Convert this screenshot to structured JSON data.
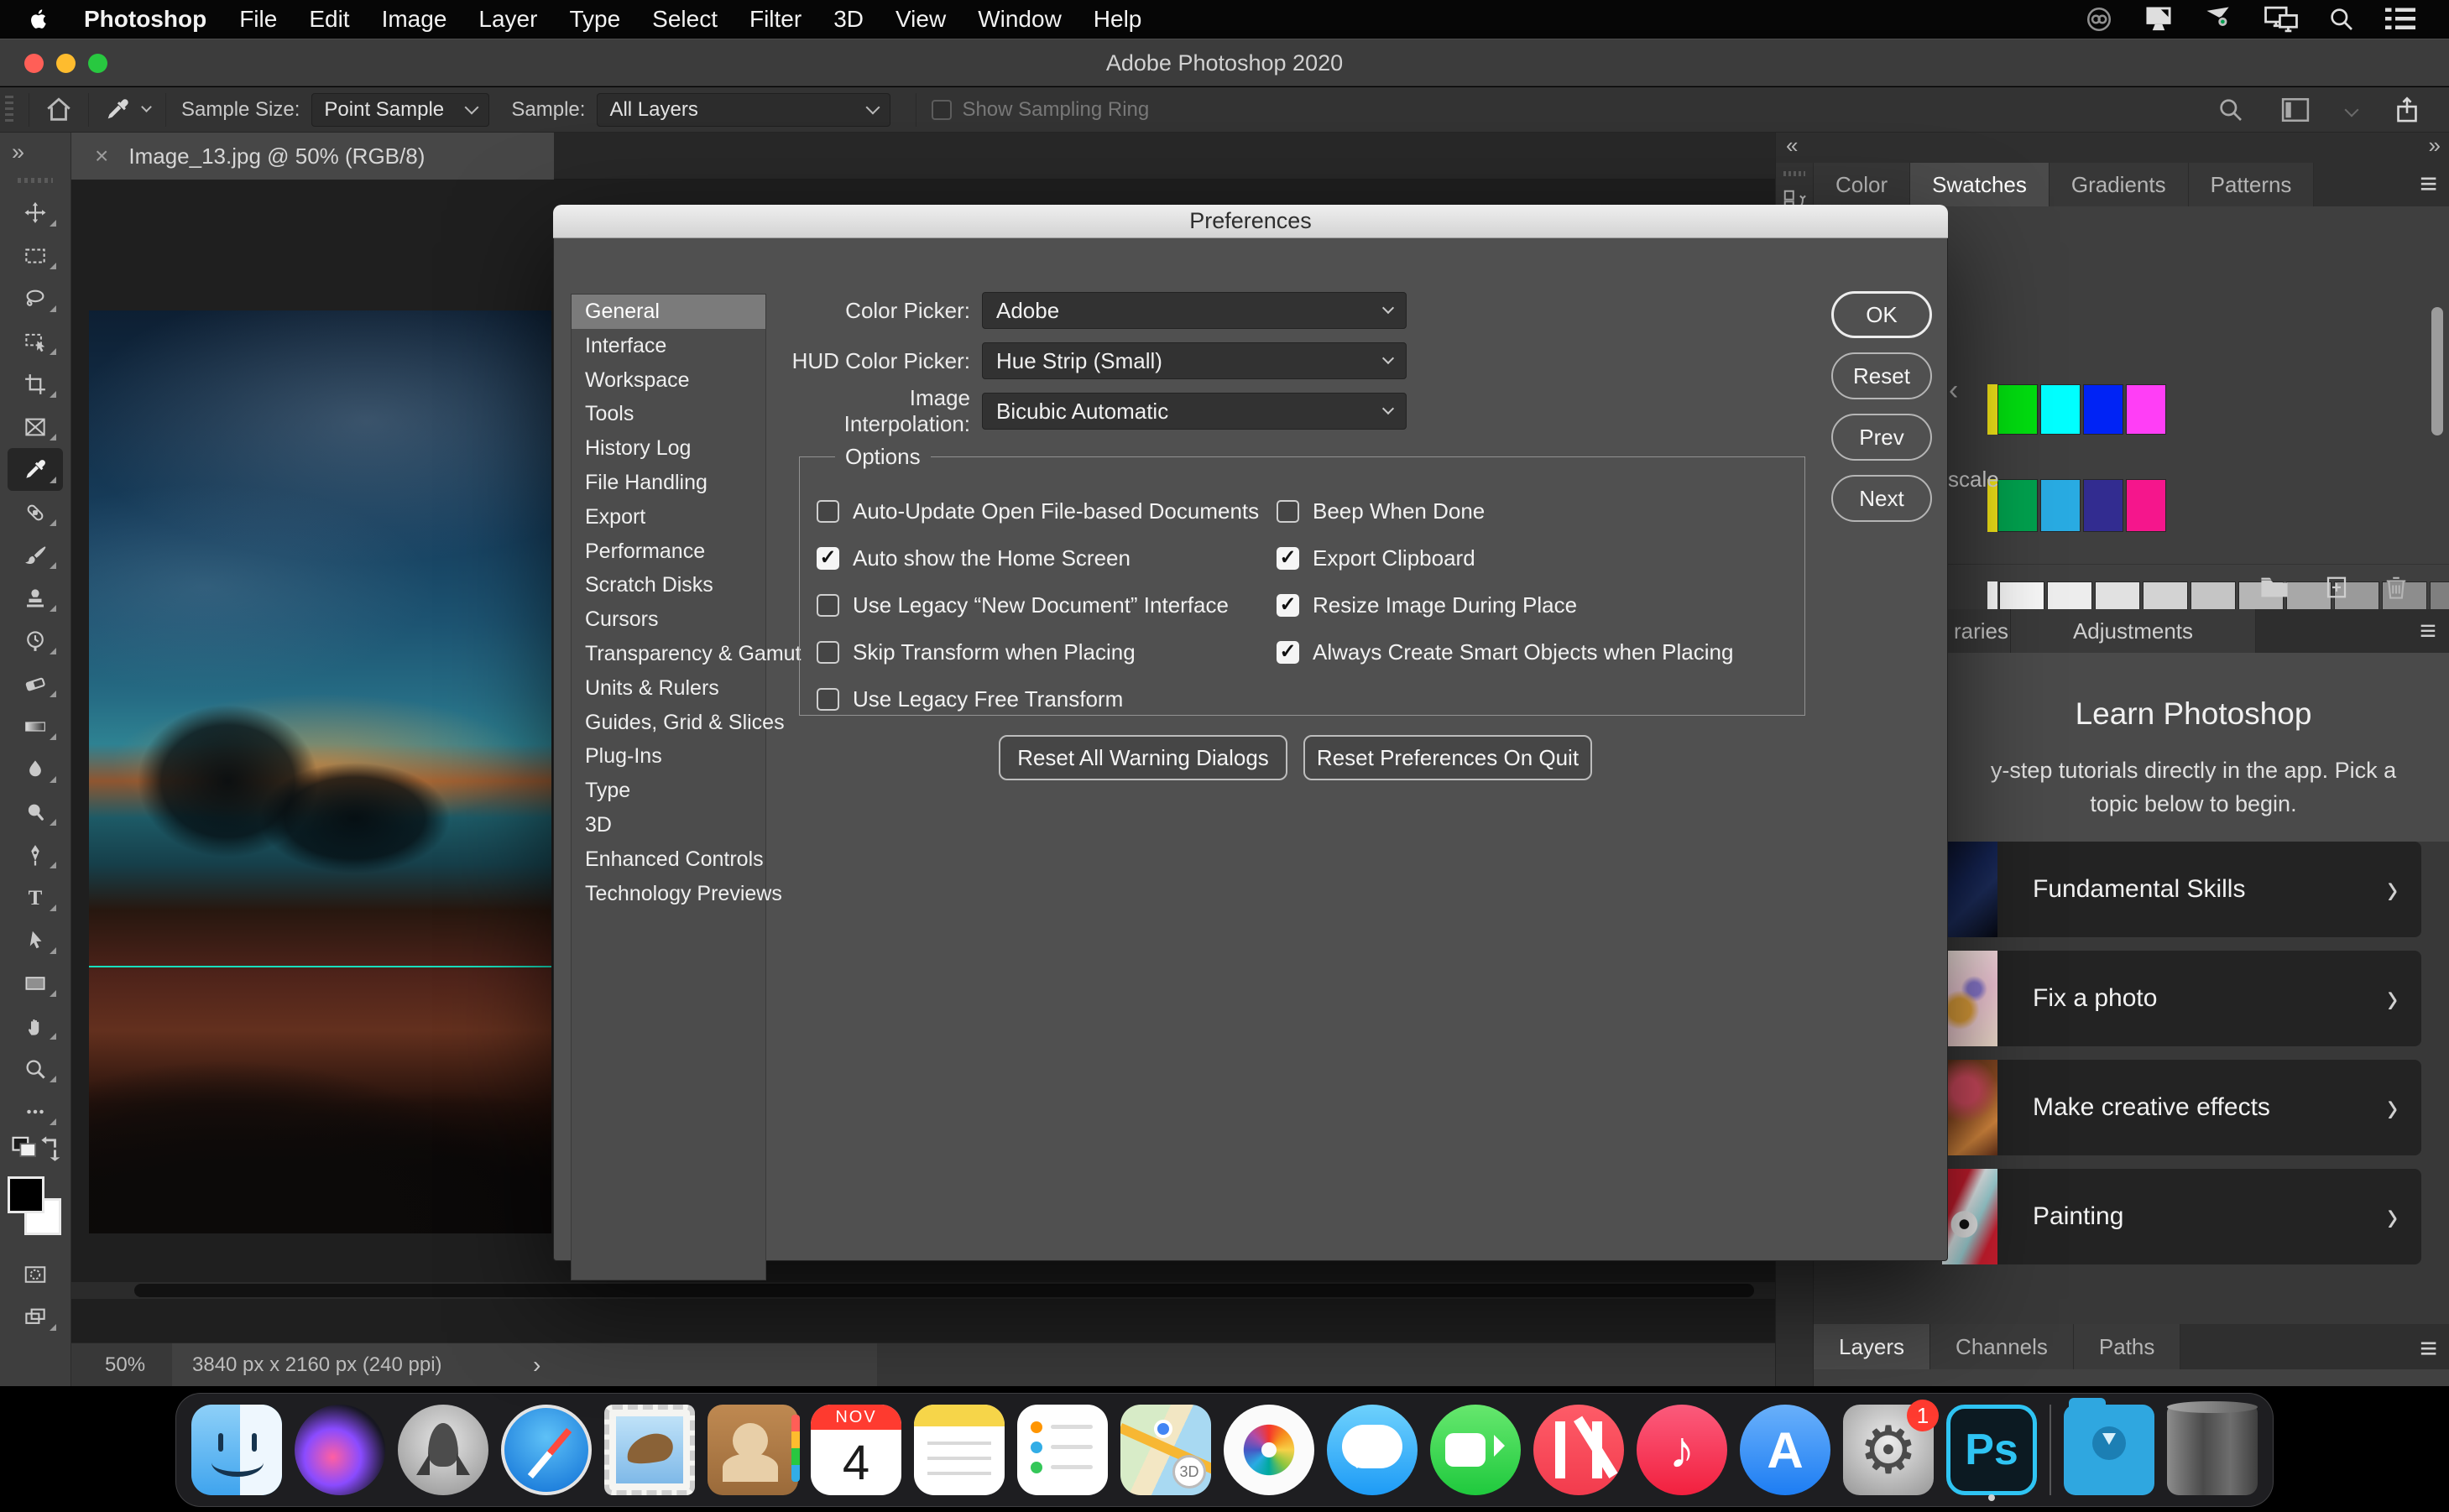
{
  "menu_bar": {
    "app_name": "Photoshop",
    "menus": [
      "File",
      "Edit",
      "Image",
      "Layer",
      "Type",
      "Select",
      "Filter",
      "3D",
      "View",
      "Window",
      "Help"
    ],
    "status_icons": [
      "creative-cloud",
      "display",
      "projector",
      "screen-mirroring",
      "spotlight",
      "notification-list"
    ]
  },
  "title_bar": {
    "title": "Adobe Photoshop 2020"
  },
  "options_bar": {
    "sample_size_label": "Sample Size:",
    "sample_size_value": "Point Sample",
    "sample_label": "Sample:",
    "sample_value": "All Layers",
    "sampling_ring_label": "Show Sampling Ring"
  },
  "document": {
    "tab_title": "Image_13.jpg @ 50% (RGB/8)",
    "zoom_level": "50%",
    "dimensions": "3840 px x 2160 px (240 ppi)"
  },
  "toolbar_tools": [
    "move",
    "marquee",
    "lasso",
    "object-selection",
    "crop",
    "frame",
    "eyedropper",
    "healing-brush",
    "brush",
    "clone-stamp",
    "history-brush",
    "eraser",
    "gradient",
    "blur",
    "dodge",
    "pen",
    "type",
    "path-selection",
    "rectangle",
    "hand",
    "zoom",
    "edit-toolbar",
    "quick-mask",
    "screen-mode"
  ],
  "toolbar_selected_tool": "eyedropper",
  "preferences": {
    "title": "Preferences",
    "sections": [
      {
        "label": "General",
        "selected": true
      },
      {
        "label": "Interface"
      },
      {
        "label": "Workspace"
      },
      {
        "label": "Tools"
      },
      {
        "label": "History Log"
      },
      {
        "label": "File Handling"
      },
      {
        "label": "Export"
      },
      {
        "label": "Performance"
      },
      {
        "label": "Scratch Disks"
      },
      {
        "label": "Cursors"
      },
      {
        "label": "Transparency & Gamut"
      },
      {
        "label": "Units & Rulers"
      },
      {
        "label": "Guides, Grid & Slices"
      },
      {
        "label": "Plug-Ins"
      },
      {
        "label": "Type"
      },
      {
        "label": "3D"
      },
      {
        "label": "Enhanced Controls"
      },
      {
        "label": "Technology Previews"
      }
    ],
    "fields": [
      {
        "label": "Color Picker:",
        "value": "Adobe"
      },
      {
        "label": "HUD Color Picker:",
        "value": "Hue Strip (Small)"
      },
      {
        "label": "Image Interpolation:",
        "value": "Bicubic Automatic"
      }
    ],
    "options_group": {
      "legend": "Options",
      "left": [
        {
          "label": "Auto-Update Open File-based Documents",
          "checked": false
        },
        {
          "label": "Auto show the Home Screen",
          "checked": true
        },
        {
          "label": "Use Legacy “New Document” Interface",
          "checked": false
        },
        {
          "label": "Skip Transform when Placing",
          "checked": false
        },
        {
          "label": "Use Legacy Free Transform",
          "checked": false
        }
      ],
      "right": [
        {
          "label": "Beep When Done",
          "checked": false
        },
        {
          "label": "Export Clipboard",
          "checked": true
        },
        {
          "label": "Resize Image During Place",
          "checked": true
        },
        {
          "label": "Always Create Smart Objects when Placing",
          "checked": true
        }
      ]
    },
    "footer_buttons": [
      "Reset All Warning Dialogs",
      "Reset Preferences On Quit"
    ],
    "side_buttons": [
      {
        "label": "OK",
        "primary": true
      },
      {
        "label": "Reset"
      },
      {
        "label": "Prev"
      },
      {
        "label": "Next"
      }
    ]
  },
  "right_panel": {
    "top_tabs": [
      {
        "label": "Color"
      },
      {
        "label": "Swatches",
        "active": true
      },
      {
        "label": "Gradients"
      },
      {
        "label": "Patterns"
      }
    ],
    "swatches": {
      "row1_edge": "#f2e418",
      "row1": [
        "#00df0f",
        "#00ffff",
        "#0023f5",
        "#ff3ef6"
      ],
      "row2_edge": "#f2e418",
      "row2": [
        "#00a14e",
        "#29abe2",
        "#322c90",
        "#f5168c"
      ],
      "group_label_visible": "scale",
      "gray_edge": "#ffffff",
      "grays": [
        "#f6f6f6",
        "#ededed",
        "#e1e1e1",
        "#d3d3d3",
        "#c5c5c5",
        "#b6b6b6",
        "#a8a8a8",
        "#9a9a9a",
        "#8d8d8d",
        "#7f7f7f"
      ]
    },
    "mid_tabs": [
      {
        "label": "raries"
      },
      {
        "label": "Adjustments"
      }
    ],
    "learn": {
      "title": "Learn Photoshop",
      "subtitle": "y-step tutorials directly in the app. Pick a topic below to begin.",
      "cards": [
        {
          "label": "Fundamental Skills",
          "thumb": "thumb-night"
        },
        {
          "label": "Fix a photo",
          "thumb": "thumb-flowers"
        },
        {
          "label": "Make creative effects",
          "thumb": "thumb-warm"
        },
        {
          "label": "Painting",
          "thumb": "thumb-toy"
        }
      ]
    },
    "bottom_tabs": [
      {
        "label": "Layers",
        "active": true
      },
      {
        "label": "Channels"
      },
      {
        "label": "Paths"
      }
    ]
  },
  "dock": {
    "items": [
      "finder",
      "siri",
      "launchpad",
      "safari",
      "mail",
      "contacts",
      "calendar",
      "notes",
      "reminders",
      "maps",
      "photos",
      "messages",
      "facetime",
      "news",
      "music",
      "app-store",
      "system-preferences",
      "photoshop",
      "downloads",
      "trash"
    ],
    "calendar_month": "NOV",
    "calendar_day": "4",
    "maps_badge": "3D",
    "music_glyph": "♪",
    "appstore_glyph": "A",
    "prefs_glyph": "⚙",
    "settings_badge": "1",
    "photoshop_label": "Ps"
  }
}
